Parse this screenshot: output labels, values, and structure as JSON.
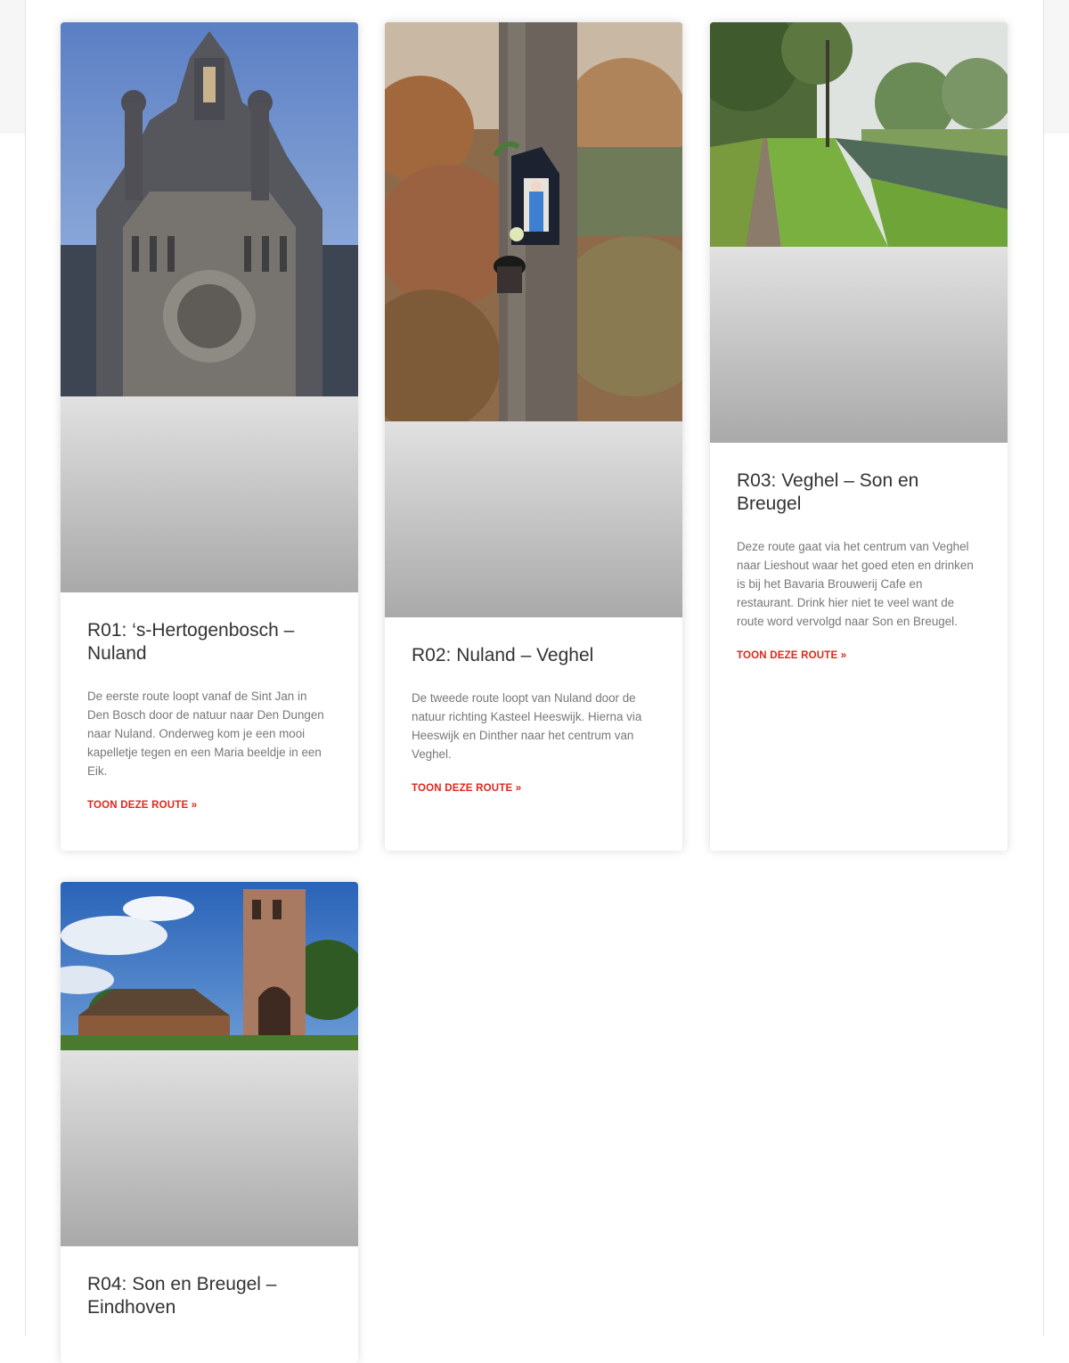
{
  "cards": [
    {
      "title": "R01: ‘s-Hertogenbosch – Nuland",
      "excerpt": "De eerste route loopt vanaf de Sint Jan in Den Bosch door de natuur naar Den Dungen naar Nuland. Onderweg kom je een mooi kapelletje tegen en een Maria beeldje in een Eik.",
      "read_more": "TOON DEZE ROUTE »"
    },
    {
      "title": "R02: Nuland – Veghel",
      "excerpt": "De tweede route loopt van Nuland door de natuur richting Kasteel Heeswijk. Hierna via Heeswijk en Dinther naar het centrum van Veghel.",
      "read_more": "TOON DEZE ROUTE »"
    },
    {
      "title": "R03: Veghel – Son en Breugel",
      "excerpt": "Deze route gaat via het centrum van Veghel naar Lieshout waar het goed eten en drinken is bij het Bavaria Brouwerij Cafe en restaurant. Drink hier niet te veel want de route word vervolgd naar Son en Breugel.",
      "read_more": "TOON DEZE ROUTE »"
    },
    {
      "title": "R04: Son en Breugel – Eindhoven",
      "excerpt": "",
      "read_more": ""
    }
  ],
  "colors": {
    "accent": "#e1261c",
    "title": "#333333",
    "text": "#777777"
  }
}
